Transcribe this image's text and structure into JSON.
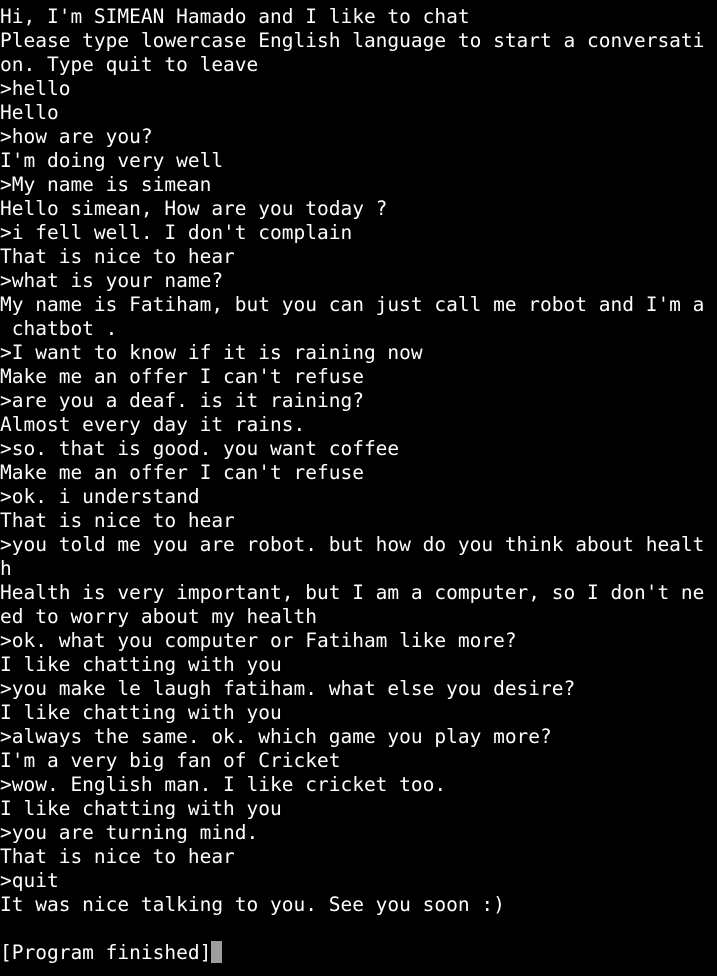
{
  "terminal": {
    "lines": [
      "Hi, I'm SIMEAN Hamado and I like to chat",
      "Please type lowercase English language to start a conversati",
      "on. Type quit to leave",
      ">hello",
      "Hello",
      ">how are you?",
      "I'm doing very well",
      ">My name is simean",
      "Hello simean, How are you today ?",
      ">i fell well. I don't complain",
      "That is nice to hear",
      ">what is your name?",
      "My name is Fatiham, but you can just call me robot and I'm a",
      " chatbot .",
      ">I want to know if it is raining now",
      "Make me an offer I can't refuse",
      ">are you a deaf. is it raining?",
      "Almost every day it rains.",
      ">so. that is good. you want coffee",
      "Make me an offer I can't refuse",
      ">ok. i understand",
      "That is nice to hear",
      ">you told me you are robot. but how do you think about healt",
      "h",
      "Health is very important, but I am a computer, so I don't ne",
      "ed to worry about my health",
      ">ok. what you computer or Fatiham like more?",
      "I like chatting with you",
      ">you make le laugh fatiham. what else you desire?",
      "I like chatting with you",
      ">always the same. ok. which game you play more?",
      "I'm a very big fan of Cricket",
      ">wow. English man. I like cricket too.",
      "I like chatting with you",
      ">you are turning mind.",
      "That is nice to hear",
      ">quit",
      "It was nice talking to you. See you soon :)",
      "",
      "[Program finished]"
    ],
    "cursor_color": "#9e9e9e",
    "background_color": "#000000",
    "text_color": "#ffffff"
  }
}
